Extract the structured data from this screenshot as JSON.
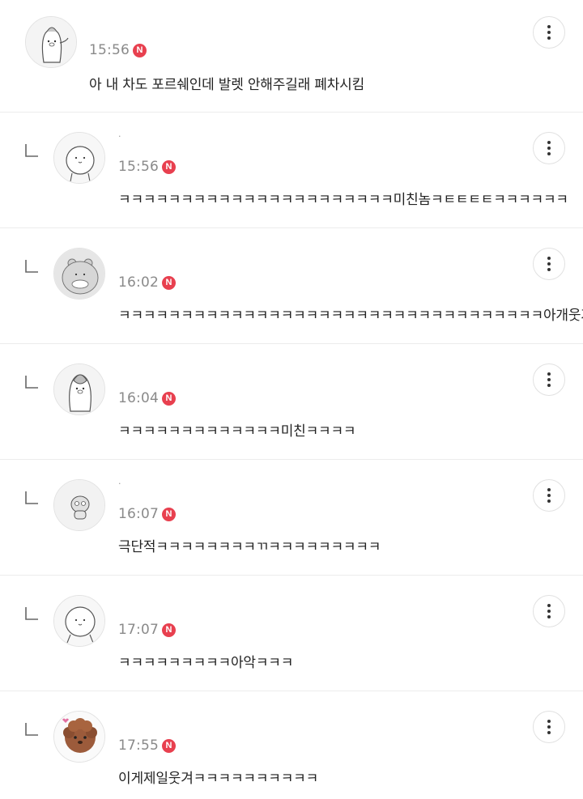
{
  "colors": {
    "new_badge": "#e8404f",
    "time_text": "#8a8a8a",
    "divider": "#ececec"
  },
  "icons": {
    "reply": "reply-arrow-icon",
    "more": "more-vertical-icon"
  },
  "comments": [
    {
      "nickname": "",
      "time": "15:56",
      "badge": "N",
      "text": "아 내 차도 포르쉐인데 발렛 안해주길래 폐차시킴",
      "avatar": "penguin"
    },
    {
      "nickname": "·",
      "time": "15:56",
      "badge": "N",
      "text": "ㅋㅋㅋㅋㅋㅋㅋㅋㅋㅋㅋㅋㅋㅋㅋㅋㅋㅋㅋㅋㅋㅋ미친놈ㅋㅌㅌㅌㅌㅋㅋㅋㅋㅋㅋ",
      "avatar": "blob"
    },
    {
      "nickname": "",
      "time": "16:02",
      "badge": "N",
      "text": "ㅋㅋㅋㅋㅋㅋㅋㅋㅋㅋㅋㅋㅋㅋㅋㅋㅋㅋㅋㅋㅋㅋㅋㅋㅋㅋㅋㅋㅋㅋㅋㅋㅋㅋ아개웃겨",
      "avatar": "hamster"
    },
    {
      "nickname": "",
      "time": "16:04",
      "badge": "N",
      "text": "ㅋㅋㅋㅋㅋㅋㅋㅋㅋㅋㅋㅋㅋ미친ㅋㅋㅋㅋ",
      "avatar": "penguin"
    },
    {
      "nickname": "·",
      "time": "16:07",
      "badge": "N",
      "text": "극단적ㅋㅋㅋㅋㅋㅋㅋㅋㄲㅋㅋㅋㅋㅋㅋㅋㅋㅋ",
      "avatar": "mini"
    },
    {
      "nickname": "",
      "time": "17:07",
      "badge": "N",
      "text": "ㅋㅋㅋㅋㅋㅋㅋㅋㅋ아악ㅋㅋㅋ",
      "avatar": "blob"
    },
    {
      "nickname": "",
      "time": "17:55",
      "badge": "N",
      "text": "이게제일웃겨ㅋㅋㅋㅋㅋㅋㅋㅋㅋㅋ",
      "avatar": "poodle"
    }
  ]
}
